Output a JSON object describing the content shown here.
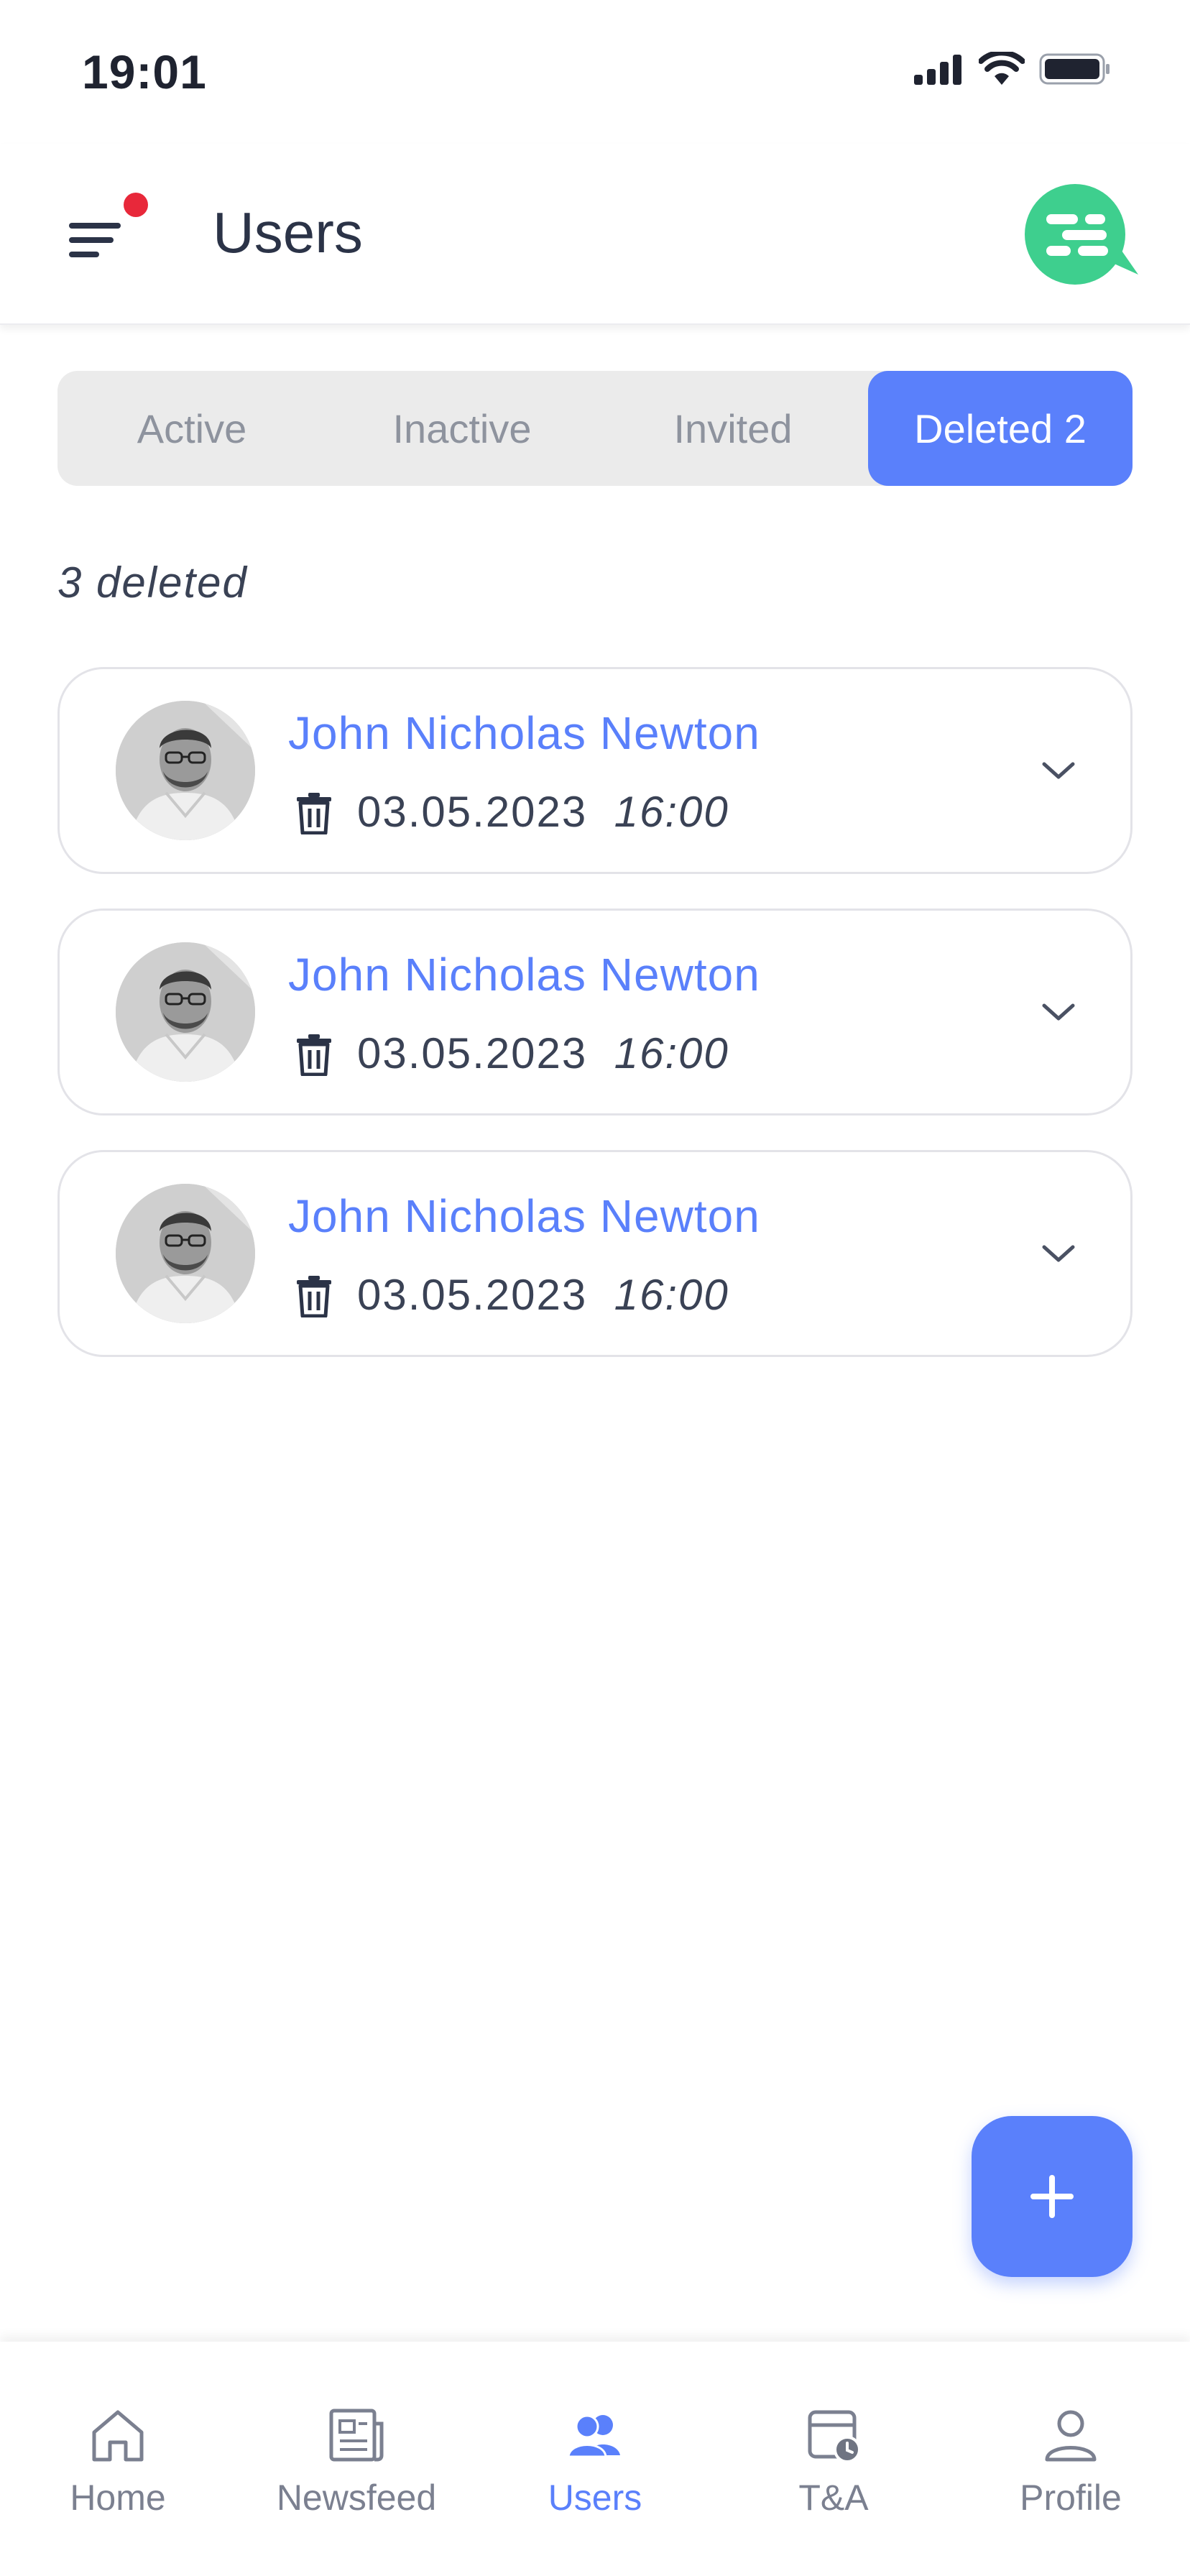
{
  "status_bar": {
    "time": "19:01"
  },
  "header": {
    "title": "Users"
  },
  "tabs": [
    {
      "label": "Active"
    },
    {
      "label": "Inactive"
    },
    {
      "label": "Invited"
    },
    {
      "label": "Deleted 2",
      "selected": true
    }
  ],
  "list": {
    "count_label": "3 deleted",
    "items": [
      {
        "name": "John Nicholas Newton",
        "date": "03.05.2023",
        "time": "16:00"
      },
      {
        "name": "John Nicholas Newton",
        "date": "03.05.2023",
        "time": "16:00"
      },
      {
        "name": "John Nicholas Newton",
        "date": "03.05.2023",
        "time": "16:00"
      }
    ]
  },
  "fab": {
    "icon": "plus-icon"
  },
  "bottom_nav": [
    {
      "label": "Home",
      "icon": "home-icon"
    },
    {
      "label": "Newsfeed",
      "icon": "newsfeed-icon"
    },
    {
      "label": "Users",
      "icon": "users-icon",
      "active": true
    },
    {
      "label": "T&A",
      "icon": "calendar-clock-icon"
    },
    {
      "label": "Profile",
      "icon": "profile-icon"
    }
  ],
  "colors": {
    "accent": "#5a80fb",
    "brand_green": "#3ecf8e",
    "notification": "#e8283a",
    "text": "#2b3347"
  }
}
